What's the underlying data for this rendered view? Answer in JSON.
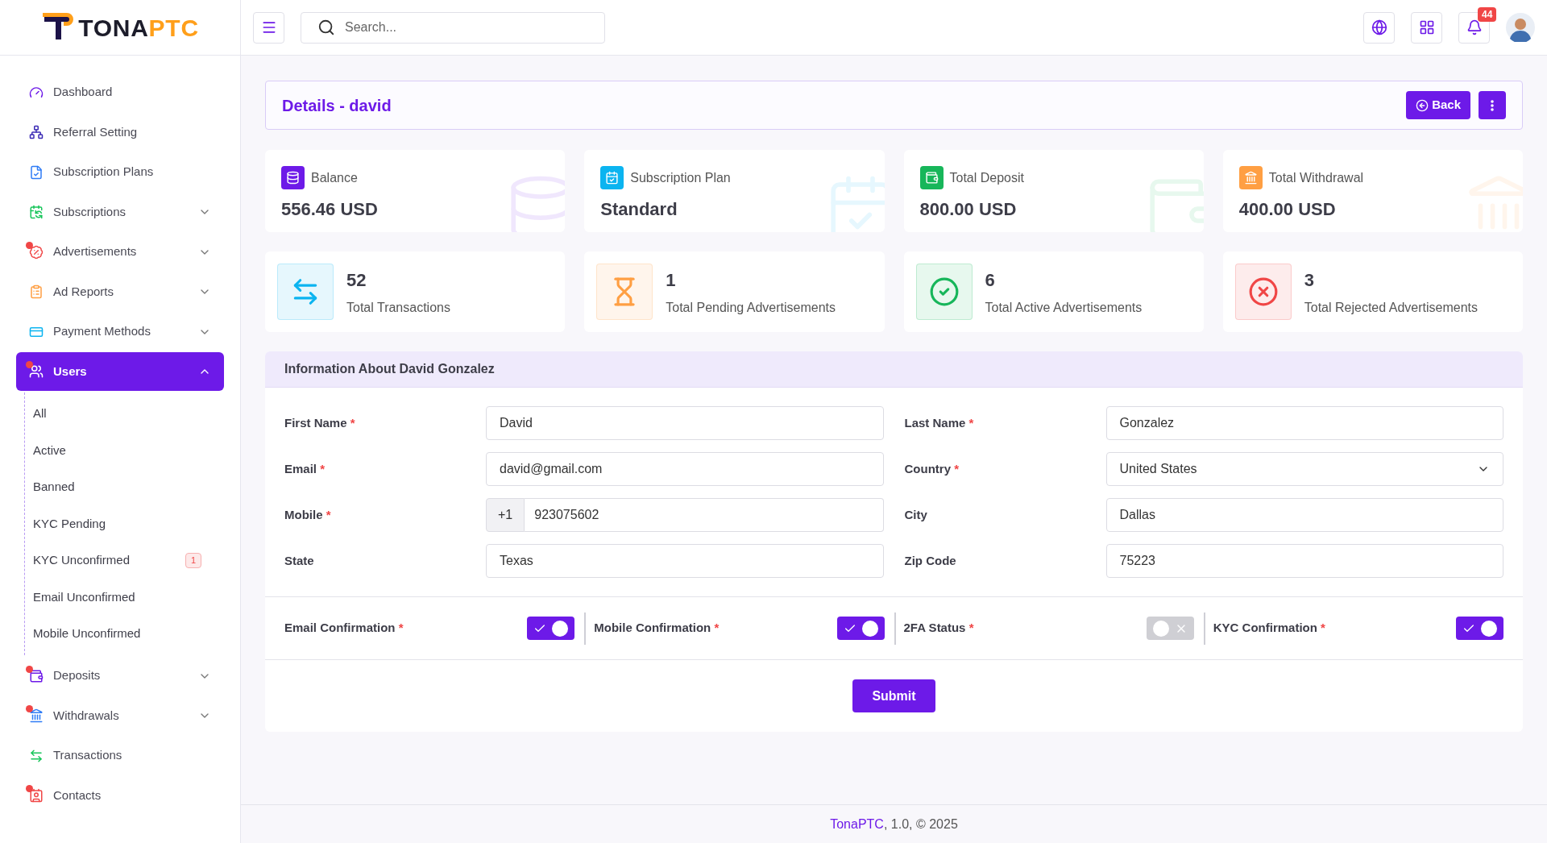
{
  "logo": {
    "part_1": "TONA",
    "part_2": "PTC"
  },
  "sidebar": {
    "items": [
      {
        "label": "Dashboard",
        "dot": false,
        "selected": false
      },
      {
        "label": "Referral Setting",
        "dot": false,
        "selected": false
      },
      {
        "label": "Subscription Plans",
        "dot": false,
        "selected": false
      },
      {
        "label": "Subscriptions",
        "dot": false,
        "selected": false,
        "expanded": false
      },
      {
        "label": "Advertisements",
        "dot": true,
        "selected": false,
        "expanded": false
      },
      {
        "label": "Ad Reports",
        "dot": false,
        "selected": false,
        "expanded": false
      },
      {
        "label": "Payment Methods",
        "dot": false,
        "selected": false,
        "expanded": false
      },
      {
        "label": "Users",
        "dot": true,
        "expanded": true,
        "selected": true,
        "children": [
          {
            "label": "All"
          },
          {
            "label": "Active"
          },
          {
            "label": "Banned"
          },
          {
            "label": "KYC Pending"
          },
          {
            "label": "KYC Unconfirmed",
            "badge": "1"
          },
          {
            "label": "Email Unconfirmed"
          },
          {
            "label": "Mobile Unconfirmed"
          }
        ]
      },
      {
        "label": "Deposits",
        "dot": true,
        "selected": false,
        "expanded": false
      },
      {
        "label": "Withdrawals",
        "dot": true,
        "selected": false,
        "expanded": false
      },
      {
        "label": "Transactions",
        "dot": false,
        "selected": false
      },
      {
        "label": "Contacts",
        "dot": true,
        "selected": false
      }
    ]
  },
  "header": {
    "search": {
      "placeholder": "Search..."
    },
    "notifications": "44"
  },
  "page_title": "Details - david",
  "back_button": "Back",
  "summary_cards": [
    {
      "label": "Balance",
      "value": "556.46 USD",
      "color": "#6d1ae8"
    },
    {
      "label": "Subscription Plan",
      "value": "Standard",
      "color": "#0bb4f0"
    },
    {
      "label": "Total Deposit",
      "value": "800.00 USD",
      "color": "#17b65a"
    },
    {
      "label": "Total Withdrawal",
      "value": "400.00 USD",
      "color": "#ff9f43"
    }
  ],
  "count_cards": [
    {
      "value": "52",
      "label": "Total Transactions",
      "color": "#0bb4f0"
    },
    {
      "value": "1",
      "label": "Total Pending Advertisements",
      "color": "#ff9f43"
    },
    {
      "value": "6",
      "label": "Total Active Advertisements",
      "color": "#17b65a"
    },
    {
      "value": "3",
      "label": "Total Rejected Advertisements",
      "color": "#f04646"
    }
  ],
  "info": {
    "title": "Information About David Gonzalez",
    "fields": [
      {
        "label": "First Name",
        "required_mark": "*",
        "kind": "text",
        "value": "David"
      },
      {
        "label": "Last Name",
        "required_mark": "*",
        "kind": "text",
        "value": "Gonzalez"
      },
      {
        "label": "Email",
        "required_mark": "*",
        "kind": "text",
        "value": "david@gmail.com"
      },
      {
        "label": "Country",
        "required_mark": "*",
        "kind": "select",
        "value": "United States"
      },
      {
        "label": "Mobile",
        "required_mark": "*",
        "kind": "phone",
        "prefix": "+1",
        "value": "923075602"
      },
      {
        "label": "City",
        "kind": "text",
        "value": "Dallas"
      },
      {
        "label": "State",
        "kind": "text",
        "value": "Texas"
      },
      {
        "label": "Zip Code",
        "kind": "text",
        "value": "75223"
      }
    ],
    "toggles": [
      {
        "label": "Email Confirmation",
        "required_mark": "*",
        "on": true
      },
      {
        "label": "Mobile Confirmation",
        "required_mark": "*",
        "on": true
      },
      {
        "label": "2FA Status",
        "required_mark": "*",
        "on": false
      },
      {
        "label": "KYC Confirmation",
        "required_mark": "*",
        "on": true
      }
    ],
    "submit": "Submit"
  },
  "footer": {
    "brand": "TonaPTC",
    "text": ", 1.0, © 2025"
  }
}
